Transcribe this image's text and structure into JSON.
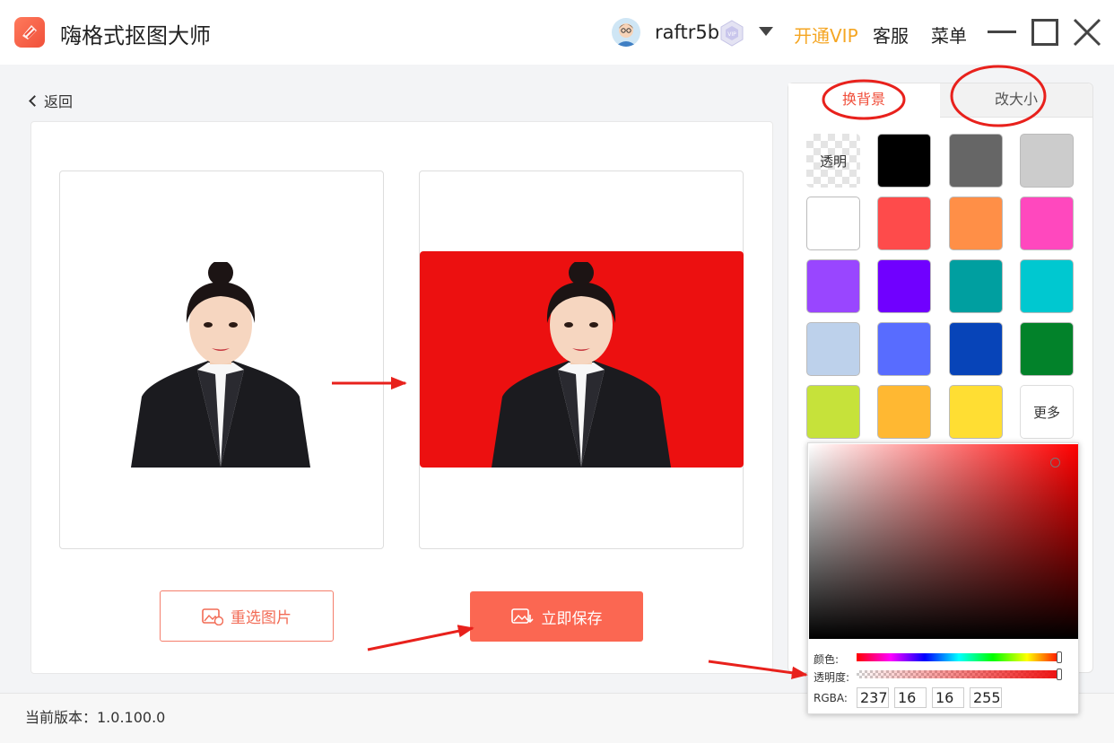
{
  "app": {
    "title": "嗨格式抠图大师"
  },
  "header": {
    "username": "raftr5b",
    "vip_label": "开通VIP",
    "service_label": "客服",
    "menu_label": "菜单"
  },
  "nav": {
    "back_label": "返回"
  },
  "actions": {
    "reselect_label": "重选图片",
    "save_label": "立即保存"
  },
  "footer": {
    "version_label": "当前版本：1.0.100.0"
  },
  "sidebar": {
    "tabs": [
      {
        "label": "换背景",
        "active": true
      },
      {
        "label": "改大小",
        "active": false
      }
    ],
    "swatches": [
      {
        "type": "transparent",
        "label": "透明"
      },
      {
        "color": "#000000"
      },
      {
        "color": "#666666"
      },
      {
        "color": "#cccccc"
      },
      {
        "color": "#ffffff"
      },
      {
        "color": "#fe4b4b"
      },
      {
        "color": "#ff8f47"
      },
      {
        "color": "#ff48be"
      },
      {
        "color": "#9946ff"
      },
      {
        "color": "#7000ff"
      },
      {
        "color": "#009fa0"
      },
      {
        "color": "#00c8d0"
      },
      {
        "color": "#bdd1eb"
      },
      {
        "color": "#586cff"
      },
      {
        "color": "#0744b8"
      },
      {
        "color": "#02822a"
      },
      {
        "color": "#c6e23a"
      },
      {
        "color": "#ffb832"
      },
      {
        "color": "#ffde33"
      },
      {
        "type": "more",
        "label": "更多"
      }
    ]
  },
  "color_picker": {
    "hue_label": "颜色:",
    "alpha_label": "透明度:",
    "rgba_label": "RGBA:",
    "r": "237",
    "g": "16",
    "b": "16",
    "a": "255",
    "selected_color": "#ed1010"
  },
  "colors": {
    "accent": "#fb6752",
    "vip": "#f5a623",
    "result_background": "#ec1010"
  }
}
